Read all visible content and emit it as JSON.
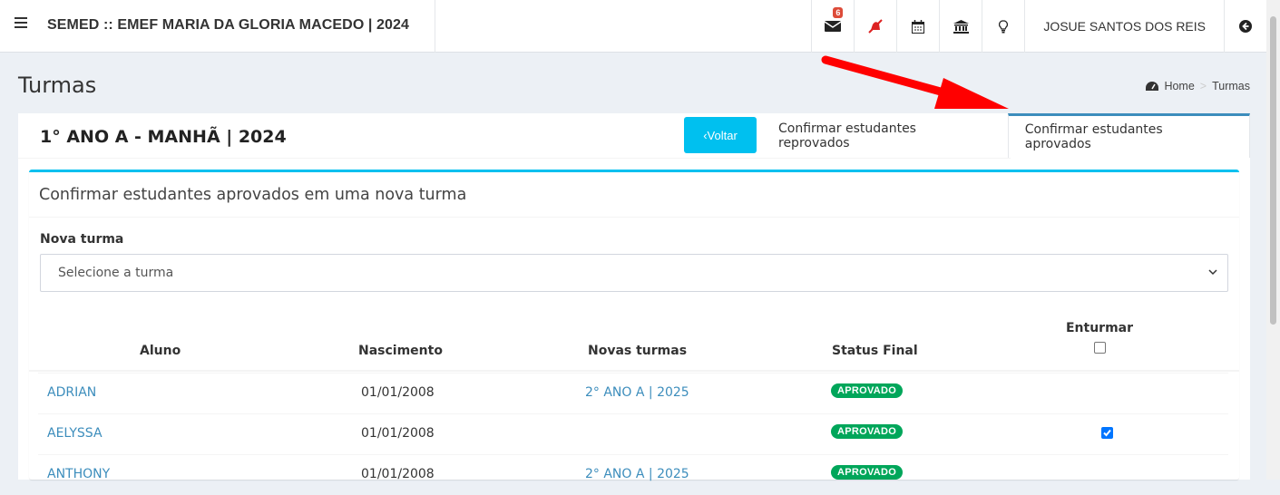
{
  "topbar": {
    "title": "SEMED :: EMEF MARIA DA GLORIA MACEDO | 2024",
    "mail_badge": "6",
    "user_name": "JOSUE SANTOS DOS REIS",
    "icons": [
      "bars-icon",
      "envelope-icon",
      "bell-slash-icon",
      "calendar-icon",
      "bank-icon",
      "lightbulb-icon",
      "arrow-circle-icon"
    ]
  },
  "page": {
    "title": "Turmas",
    "breadcrumb": {
      "home": "Home",
      "current": "Turmas"
    }
  },
  "box": {
    "title": "1° ANO A - MANHÃ | 2024",
    "back_button": "‹Voltar",
    "tabs": [
      "Confirmar estudantes reprovados",
      "Confirmar estudantes aprovados"
    ],
    "active_tab": 1
  },
  "panel": {
    "title": "Confirmar estudantes aprovados em uma nova turma",
    "field_label": "Nova turma",
    "select_placeholder": "Selecione a turma",
    "columns": {
      "aluno": "Aluno",
      "nascimento": "Nascimento",
      "novas_turmas": "Novas turmas",
      "status": "Status Final",
      "enturmar": "Enturmar"
    },
    "rows": [
      {
        "aluno": "ADRIAN",
        "nascimento": "01/01/2008",
        "nova_turma": "2° ANO A | 2025",
        "status": "APROVADO",
        "checked": false
      },
      {
        "aluno": "AELYSSA",
        "nascimento": "01/01/2008",
        "nova_turma": "",
        "status": "APROVADO",
        "checked": true
      },
      {
        "aluno": "ANTHONY",
        "nascimento": "01/01/2008",
        "nova_turma": "2° ANO A | 2025",
        "status": "APROVADO",
        "checked": false
      }
    ]
  },
  "colors": {
    "accent_info": "#00c0ef",
    "accent_primary": "#3c8dbc",
    "success": "#00a65a",
    "annotation_arrow": "#ff0000"
  }
}
